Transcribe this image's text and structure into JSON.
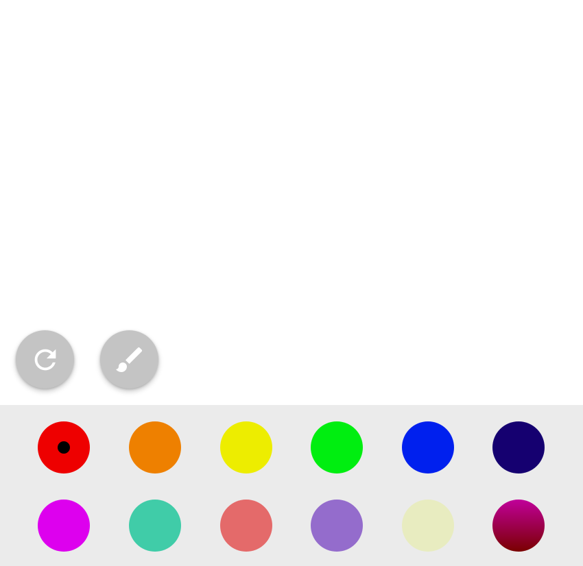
{
  "toolbar": {
    "reset_icon": "refresh-icon",
    "brush_icon": "brush-icon",
    "button_color": "#c4c4c4",
    "icon_color": "#ffffff"
  },
  "palette": {
    "background": "#ebebeb",
    "selected_index": 0,
    "swatches": [
      {
        "color": "#ee0000",
        "selected": true
      },
      {
        "color": "#ee8000",
        "selected": false
      },
      {
        "color": "#eded00",
        "selected": false
      },
      {
        "color": "#00ee10",
        "selected": false
      },
      {
        "color": "#0020ee",
        "selected": false
      },
      {
        "color": "#150070",
        "selected": false
      },
      {
        "color": "#dd00ee",
        "selected": false
      },
      {
        "color": "#40cca8",
        "selected": false
      },
      {
        "color": "#e46a6a",
        "selected": false
      },
      {
        "color": "#946ccc",
        "selected": false
      },
      {
        "color": "#e8ecc0",
        "selected": false
      },
      {
        "gradient_top": "#c0009a",
        "gradient_bottom": "#7a0000",
        "selected": false
      }
    ]
  }
}
